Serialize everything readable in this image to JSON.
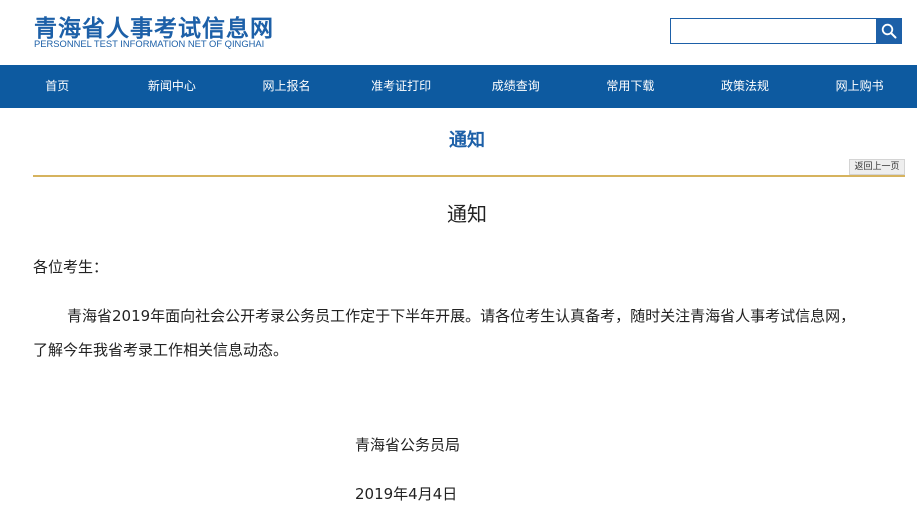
{
  "site": {
    "title": "青海省人事考试信息网",
    "subtitle": "PERSONNEL TEST INFORMATION NET OF QINGHAI"
  },
  "search": {
    "value": "",
    "placeholder": "",
    "icon": "search-icon"
  },
  "nav": {
    "items": [
      {
        "label": "首页"
      },
      {
        "label": "新闻中心"
      },
      {
        "label": "网上报名"
      },
      {
        "label": "准考证打印"
      },
      {
        "label": "成绩查询"
      },
      {
        "label": "常用下载"
      },
      {
        "label": "政策法规"
      },
      {
        "label": "网上购书"
      }
    ]
  },
  "page": {
    "section_title": "通知",
    "back_label": "返回上一页"
  },
  "article": {
    "title": "通知",
    "greeting": "各位考生：",
    "paragraph_line1": "青海省2019年面向社会公开考录公务员工作定于下半年开展。请各位考生认真备考，随时关注青海省人事考试信息网，",
    "paragraph_line2": "了解今年我省考录工作相关信息动态。",
    "signature": "青海省公务员局",
    "date": "2019年4月4日"
  },
  "colors": {
    "brand_blue": "#1d60a8",
    "nav_bg": "#0d5aa0",
    "divider_gold": "#d6b35e"
  }
}
